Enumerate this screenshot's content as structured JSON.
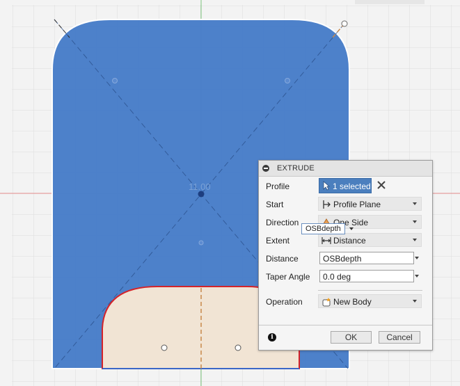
{
  "viewport": {
    "dimension_label": "11.00",
    "colors": {
      "body": "#4a7fca",
      "profile": "#f1e4d4",
      "edge": "#d4232a",
      "grid": "#d8d8d8",
      "background": "#f3f3f3"
    }
  },
  "float_input": {
    "value": "OSBdepth"
  },
  "dialog": {
    "title": "EXTRUDE",
    "profile": {
      "label": "Profile",
      "value": "1 selected"
    },
    "start": {
      "label": "Start",
      "value": "Profile Plane"
    },
    "direction": {
      "label": "Direction",
      "value": "One Side"
    },
    "extent": {
      "label": "Extent",
      "value": "Distance"
    },
    "distance": {
      "label": "Distance",
      "value": "OSBdepth"
    },
    "taper": {
      "label": "Taper Angle",
      "value": "0.0 deg"
    },
    "operation": {
      "label": "Operation",
      "value": "New Body"
    },
    "ok_label": "OK",
    "cancel_label": "Cancel",
    "icons": {
      "collapse": "collapse-icon",
      "cursor": "cursor-arrow-icon",
      "clear": "close-icon",
      "start": "profile-plane-icon",
      "direction": "one-side-icon",
      "extent": "distance-icon",
      "operation": "new-body-icon",
      "info": "info-icon"
    }
  }
}
